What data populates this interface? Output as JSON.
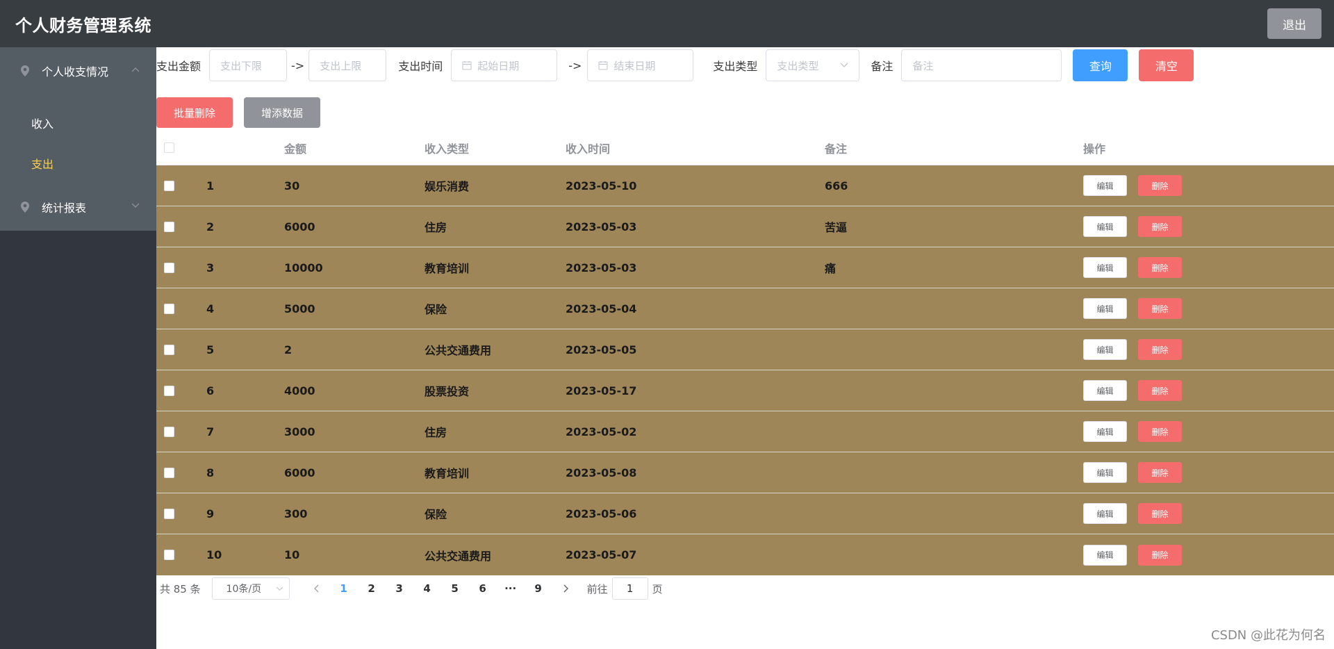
{
  "header": {
    "title": "个人财务管理系统",
    "logout_label": "退出"
  },
  "sidebar": {
    "group1": {
      "label": "个人收支情况",
      "items": [
        "收入",
        "支出"
      ]
    },
    "group2": {
      "label": "统计报表"
    }
  },
  "filters": {
    "amount_label": "支出金额",
    "amount_min_placeholder": "支出下限",
    "amount_max_placeholder": "支出上限",
    "arrow": "->",
    "time_label": "支出时间",
    "start_placeholder": "起始日期",
    "end_placeholder": "结束日期",
    "type_label": "支出类型",
    "type_placeholder": "支出类型",
    "note_label": "备注",
    "note_placeholder": "备注",
    "query_label": "查询",
    "clear_label": "清空"
  },
  "actions": {
    "bulk_delete_label": "批量删除",
    "add_label": "增添数据"
  },
  "table": {
    "headers": {
      "amount": "金额",
      "type": "收入类型",
      "time": "收入时间",
      "note": "备注",
      "op": "操作"
    },
    "edit_label": "编辑",
    "delete_label": "删除",
    "rows": [
      {
        "idx": "1",
        "amount": "30",
        "type": "娱乐消费",
        "time": "2023-05-10",
        "note": "666"
      },
      {
        "idx": "2",
        "amount": "6000",
        "type": "住房",
        "time": "2023-05-03",
        "note": "苦逼"
      },
      {
        "idx": "3",
        "amount": "10000",
        "type": "教育培训",
        "time": "2023-05-03",
        "note": "痛"
      },
      {
        "idx": "4",
        "amount": "5000",
        "type": "保险",
        "time": "2023-05-04",
        "note": ""
      },
      {
        "idx": "5",
        "amount": "2",
        "type": "公共交通费用",
        "time": "2023-05-05",
        "note": ""
      },
      {
        "idx": "6",
        "amount": "4000",
        "type": "股票投资",
        "time": "2023-05-17",
        "note": ""
      },
      {
        "idx": "7",
        "amount": "3000",
        "type": "住房",
        "time": "2023-05-02",
        "note": ""
      },
      {
        "idx": "8",
        "amount": "6000",
        "type": "教育培训",
        "time": "2023-05-08",
        "note": ""
      },
      {
        "idx": "9",
        "amount": "300",
        "type": "保险",
        "time": "2023-05-06",
        "note": ""
      },
      {
        "idx": "10",
        "amount": "10",
        "type": "公共交通费用",
        "time": "2023-05-07",
        "note": ""
      }
    ]
  },
  "pagination": {
    "total": "共 85 条",
    "page_size": "10条/页",
    "pages": [
      "1",
      "2",
      "3",
      "4",
      "5",
      "6",
      "···",
      "9"
    ],
    "current": "1",
    "goto_label": "前往",
    "goto_value": "1",
    "page_suffix": "页"
  },
  "watermark": "CSDN @此花为何名",
  "colors": {
    "header_bg": "#373d41",
    "sidebar_bg": "#31363f",
    "menu_bg": "#545c64",
    "row_bg": "#9e8659",
    "active_menu": "#ffd04b",
    "primary": "#409eff",
    "danger": "#f56c6c",
    "info": "#909399"
  }
}
